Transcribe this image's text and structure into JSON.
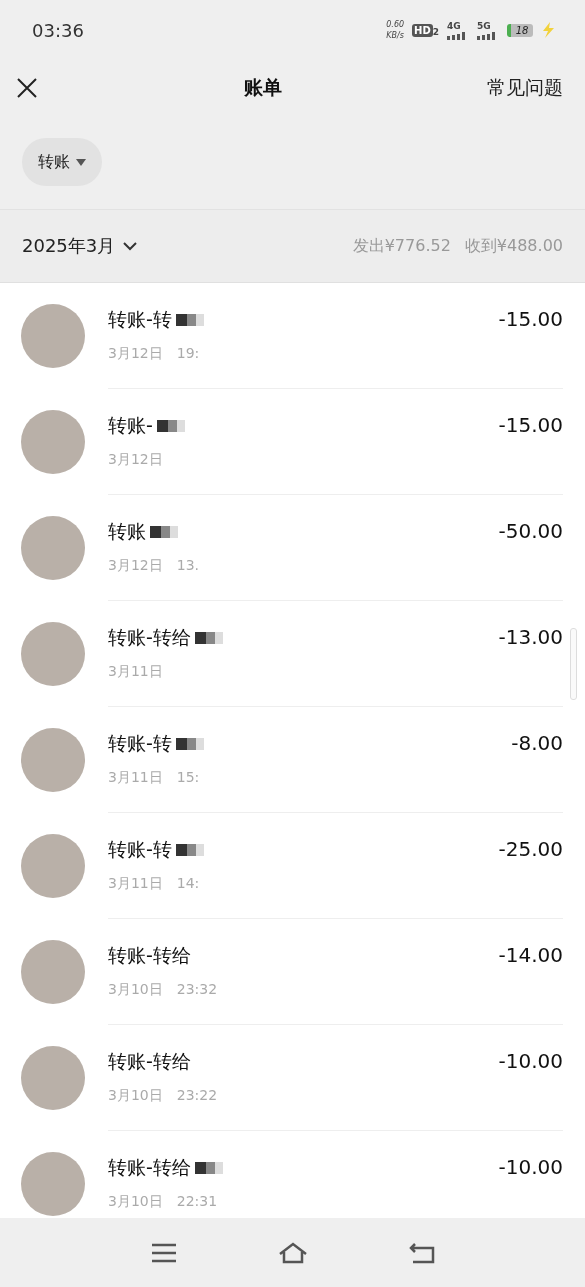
{
  "status_bar": {
    "time": "03:36",
    "speed_value": "0.60",
    "speed_unit": "KB/s",
    "hd": "HD",
    "hd_sub": "2",
    "network_1": "4G",
    "network_2": "5G",
    "battery": "18"
  },
  "header": {
    "title": "账单",
    "help": "常见问题"
  },
  "filter": {
    "label": "转账"
  },
  "summary": {
    "month": "2025年3月",
    "sent": "发出¥776.52",
    "received": "收到¥488.00"
  },
  "rows": [
    {
      "title": "转账-转",
      "date": "3月12日",
      "time": "19:",
      "amount": "-15.00",
      "redacted": true
    },
    {
      "title": "转账-",
      "date": "3月12日",
      "amount": "-15.00",
      "redacted": true
    },
    {
      "title": "转账",
      "date": "3月12日",
      "time": "13.",
      "amount": "-50.00",
      "redacted": true
    },
    {
      "title": "转账-转给",
      "date": "3月11日",
      "amount": "-13.00",
      "redacted": true
    },
    {
      "title": "转账-转",
      "date": "3月11日",
      "time": "15:",
      "amount": "-8.00",
      "redacted": true
    },
    {
      "title": "转账-转",
      "date": "3月11日",
      "time": "14:",
      "amount": "-25.00",
      "redacted": true
    },
    {
      "title": "转账-转给",
      "date": "3月10日",
      "time": "23:32",
      "amount": "-14.00",
      "redacted": false
    },
    {
      "title": "转账-转给",
      "date": "3月10日",
      "time": "23:22",
      "amount": "-10.00",
      "redacted": false
    },
    {
      "title": "转账-转给",
      "date": "3月10日",
      "time": "22:31",
      "amount": "-10.00",
      "redacted": true
    }
  ]
}
